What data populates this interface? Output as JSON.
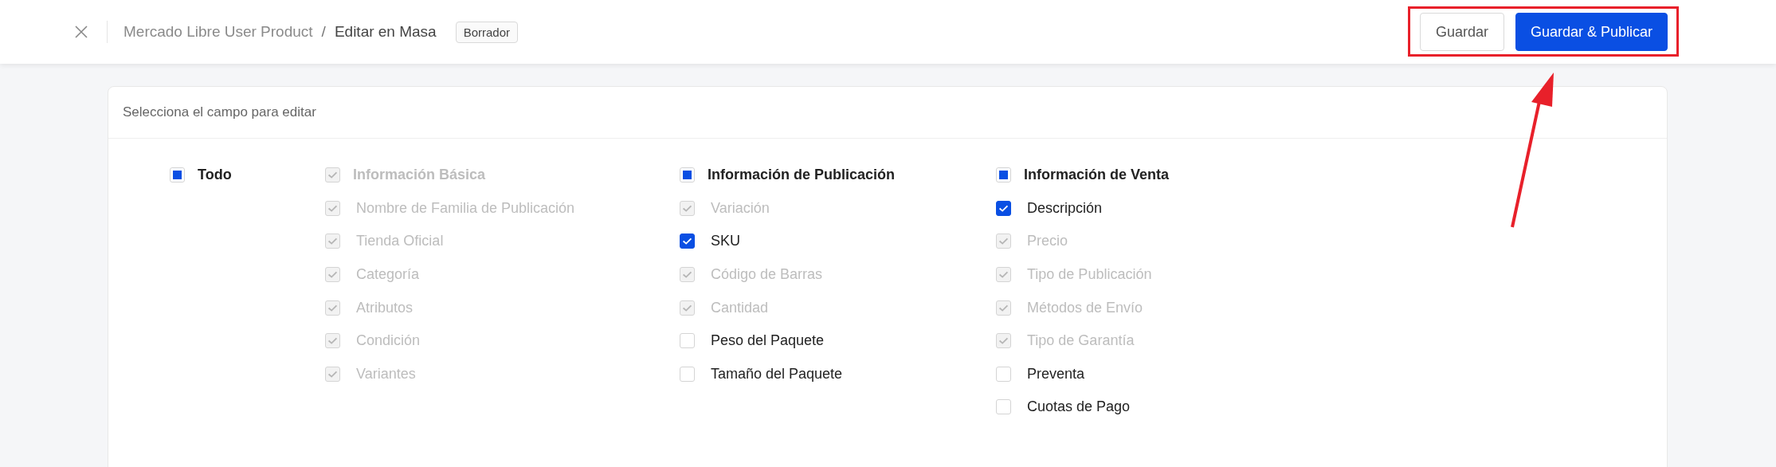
{
  "header": {
    "breadcrumb": [
      {
        "label": "Mercado Libre User Product",
        "current": false
      },
      {
        "label": "Editar en Masa",
        "current": true
      }
    ],
    "separator": "/",
    "status_tag": "Borrador",
    "buttons": [
      {
        "label": "Guardar",
        "kind": "secondary"
      },
      {
        "label": "Guardar & Publicar",
        "kind": "primary"
      }
    ]
  },
  "panel": {
    "title": "Selecciona el campo para editar",
    "all": {
      "label": "Todo",
      "indeterminate": true,
      "disabled": false
    },
    "groups": [
      {
        "label": "Información Básica",
        "checked": true,
        "disabled": true,
        "items": [
          {
            "label": "Nombre de Familia de Publicación",
            "checked": true,
            "disabled": true
          },
          {
            "label": "Tienda Oficial",
            "checked": true,
            "disabled": true
          },
          {
            "label": "Categoría",
            "checked": true,
            "disabled": true
          },
          {
            "label": "Atributos",
            "checked": true,
            "disabled": true
          },
          {
            "label": "Condición",
            "checked": true,
            "disabled": true
          },
          {
            "label": "Variantes",
            "checked": true,
            "disabled": true
          }
        ]
      },
      {
        "label": "Información de Publicación",
        "indeterminate": true,
        "disabled": false,
        "items": [
          {
            "label": "Variación",
            "checked": true,
            "disabled": true
          },
          {
            "label": "SKU",
            "checked": true,
            "disabled": false
          },
          {
            "label": "Código de Barras",
            "checked": true,
            "disabled": true
          },
          {
            "label": "Cantidad",
            "checked": true,
            "disabled": true
          },
          {
            "label": "Peso del Paquete",
            "checked": false,
            "disabled": false
          },
          {
            "label": "Tamaño del Paquete",
            "checked": false,
            "disabled": false
          }
        ]
      },
      {
        "label": "Información de Venta",
        "indeterminate": true,
        "disabled": false,
        "items": [
          {
            "label": "Descripción",
            "checked": true,
            "disabled": false
          },
          {
            "label": "Precio",
            "checked": true,
            "disabled": true
          },
          {
            "label": "Tipo de Publicación",
            "checked": true,
            "disabled": true
          },
          {
            "label": "Métodos de Envío",
            "checked": true,
            "disabled": true
          },
          {
            "label": "Tipo de Garantía",
            "checked": true,
            "disabled": true
          },
          {
            "label": "Preventa",
            "checked": false,
            "disabled": false
          },
          {
            "label": "Cuotas de Pago",
            "checked": false,
            "disabled": false
          }
        ]
      }
    ]
  }
}
